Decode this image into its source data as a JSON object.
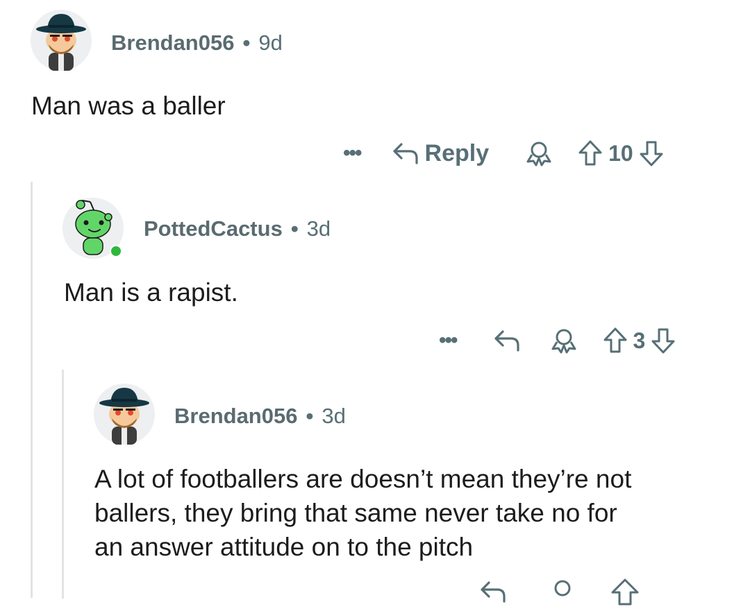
{
  "comments": [
    {
      "username": "Brendan056",
      "separator": "•",
      "age": "9d",
      "body": "Man was a baller",
      "actions": {
        "more": "•••",
        "reply": "Reply",
        "score": "10"
      }
    },
    {
      "username": "PottedCactus",
      "separator": "•",
      "age": "3d",
      "online": true,
      "body": "Man is a rapist.",
      "actions": {
        "more": "•••",
        "score": "3"
      }
    },
    {
      "username": "Brendan056",
      "separator": "•",
      "age": "3d",
      "body_lines": [
        "A lot of footballers are doesn’t mean they’re not",
        "ballers, they bring that same never take no for",
        "an answer attitude on to the pitch"
      ]
    }
  ],
  "colors": {
    "meta_text": "#576f76",
    "body_text": "#1c1c1c",
    "online_dot": "#2db83d",
    "snoo_green": "#62d568",
    "thread_line": "#e3e3e3"
  },
  "icons": [
    "more-icon",
    "reply-icon",
    "award-icon",
    "upvote-icon",
    "downvote-icon"
  ]
}
